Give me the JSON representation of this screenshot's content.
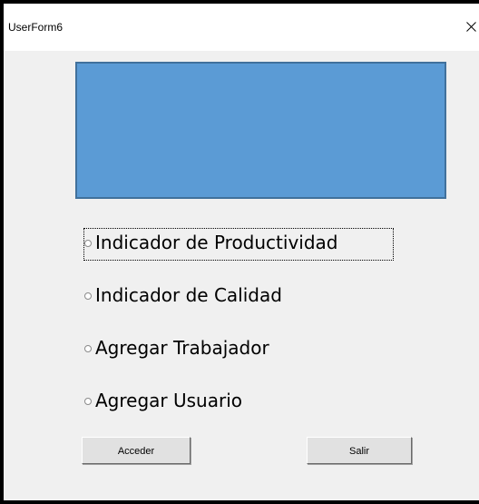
{
  "window": {
    "title": "UserForm6",
    "close_symbol": "×"
  },
  "banner": {
    "color": "#5b9bd5",
    "border_color": "#41719c"
  },
  "options": [
    {
      "label": "Indicador de Productividad",
      "selected": false,
      "focused": true
    },
    {
      "label": "Indicador de Calidad",
      "selected": false,
      "focused": false
    },
    {
      "label": "Agregar Trabajador",
      "selected": false,
      "focused": false
    },
    {
      "label": "Agregar Usuario",
      "selected": false,
      "focused": false
    }
  ],
  "buttons": {
    "accept_label": "Acceder",
    "exit_label": "Salir"
  },
  "icons": {
    "close": "close-icon",
    "radio": "radio-unchecked-icon"
  }
}
